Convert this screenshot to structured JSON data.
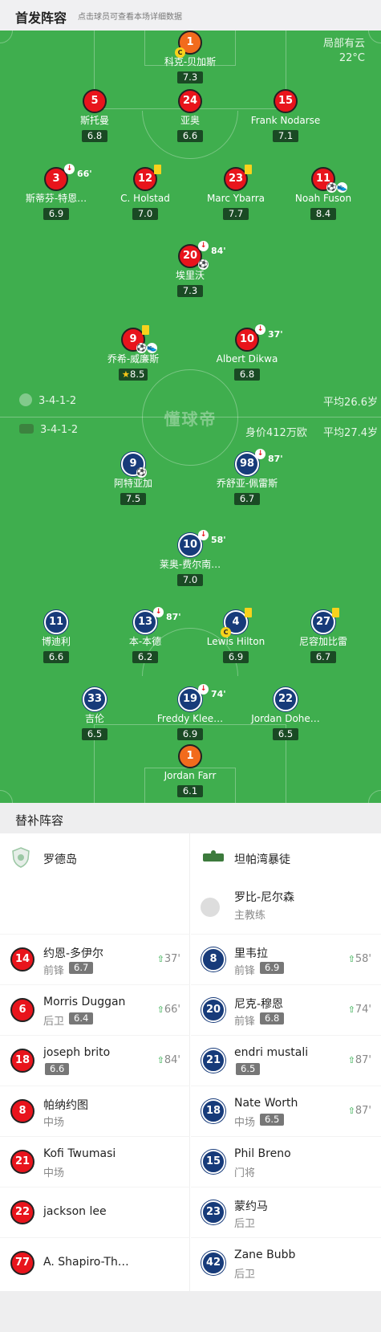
{
  "header": {
    "title": "首发阵容",
    "hint": "点击球员可查看本场详细数据"
  },
  "weather": {
    "desc": "局部有云",
    "temp": "22°C"
  },
  "home": {
    "formation": "3-4-1-2",
    "avg_age": "平均26.6岁"
  },
  "away": {
    "formation": "3-4-1-2",
    "value": "身价412万欧",
    "avg_age": "平均27.4岁"
  },
  "logo_text": "懂球帝",
  "home_players": [
    {
      "num": "1",
      "name": "科克-贝加斯",
      "rating": "7.3"
    },
    {
      "num": "5",
      "name": "斯托曼",
      "rating": "6.8"
    },
    {
      "num": "24",
      "name": "亚奥",
      "rating": "6.6"
    },
    {
      "num": "15",
      "name": "Frank Nodarse",
      "rating": "7.1"
    },
    {
      "num": "3",
      "name": "斯蒂芬-特恩…",
      "rating": "6.9",
      "mins": "66'"
    },
    {
      "num": "12",
      "name": "C. Holstad",
      "rating": "7.0"
    },
    {
      "num": "23",
      "name": "Marc Ybarra",
      "rating": "7.7"
    },
    {
      "num": "11",
      "name": "Noah Fuson",
      "rating": "8.4"
    },
    {
      "num": "20",
      "name": "埃里沃",
      "rating": "7.3",
      "mins": "84'"
    },
    {
      "num": "9",
      "name": "乔希-威廉斯",
      "rating": "8.5"
    },
    {
      "num": "10",
      "name": "Albert Dikwa",
      "rating": "6.8",
      "mins": "37'"
    }
  ],
  "away_players": [
    {
      "num": "9",
      "name": "阿特亚加",
      "rating": "7.5"
    },
    {
      "num": "98",
      "name": "乔舒亚-佩雷斯",
      "rating": "6.7",
      "mins": "87'"
    },
    {
      "num": "10",
      "name": "莱奥-费尔南…",
      "rating": "7.0",
      "mins": "58'"
    },
    {
      "num": "11",
      "name": "博迪利",
      "rating": "6.6"
    },
    {
      "num": "13",
      "name": "本-本德",
      "rating": "6.2",
      "mins": "87'"
    },
    {
      "num": "4",
      "name": "Lewis Hilton",
      "rating": "6.9"
    },
    {
      "num": "27",
      "name": "尼容加比雷",
      "rating": "6.7"
    },
    {
      "num": "33",
      "name": "吉伦",
      "rating": "6.5"
    },
    {
      "num": "19",
      "name": "Freddy Klee…",
      "rating": "6.9",
      "mins": "74'"
    },
    {
      "num": "22",
      "name": "Jordan Dohe…",
      "rating": "6.5"
    },
    {
      "num": "1",
      "name": "Jordan Farr",
      "rating": "6.1"
    }
  ],
  "subs": {
    "title": "替补阵容",
    "home_team": "罗德岛",
    "away_team": "坦帕湾暴徒",
    "coach": {
      "name": "罗比-尼尔森",
      "role": "主教练"
    },
    "home": [
      {
        "num": "14",
        "name": "约恩-多伊尔",
        "pos": "前锋",
        "rating": "6.7",
        "in": "37'"
      },
      {
        "num": "6",
        "name": "Morris Duggan",
        "pos": "后卫",
        "rating": "6.4",
        "in": "66'"
      },
      {
        "num": "18",
        "name": "joseph brito",
        "pos": "",
        "rating": "6.6",
        "in": "84'"
      },
      {
        "num": "8",
        "name": "帕纳约图",
        "pos": "中场",
        "rating": "",
        "in": ""
      },
      {
        "num": "21",
        "name": "Kofi Twumasi",
        "pos": "中场",
        "rating": "",
        "in": ""
      },
      {
        "num": "22",
        "name": "jackson lee",
        "pos": "",
        "rating": "",
        "in": ""
      },
      {
        "num": "77",
        "name": "A. Shapiro-Th…",
        "pos": "",
        "rating": "",
        "in": ""
      }
    ],
    "away": [
      {
        "num": "8",
        "name": "里韦拉",
        "pos": "前锋",
        "rating": "6.9",
        "in": "58'"
      },
      {
        "num": "20",
        "name": "尼克-穆恩",
        "pos": "前锋",
        "rating": "6.8",
        "in": "74'"
      },
      {
        "num": "21",
        "name": "endri mustali",
        "pos": "",
        "rating": "6.5",
        "in": "87'"
      },
      {
        "num": "18",
        "name": "Nate Worth",
        "pos": "中场",
        "rating": "6.5",
        "in": "87'"
      },
      {
        "num": "15",
        "name": "Phil Breno",
        "pos": "门将",
        "rating": "",
        "in": ""
      },
      {
        "num": "23",
        "name": "蒙约马",
        "pos": "后卫",
        "rating": "",
        "in": ""
      },
      {
        "num": "42",
        "name": "Zane Bubb",
        "pos": "后卫",
        "rating": "",
        "in": ""
      }
    ]
  },
  "colors": {
    "pitch": "#3fae4e",
    "home": "#e8141c",
    "away": "#173b7a",
    "gk": "#f26b1d",
    "yellow": "#f8d21c"
  }
}
